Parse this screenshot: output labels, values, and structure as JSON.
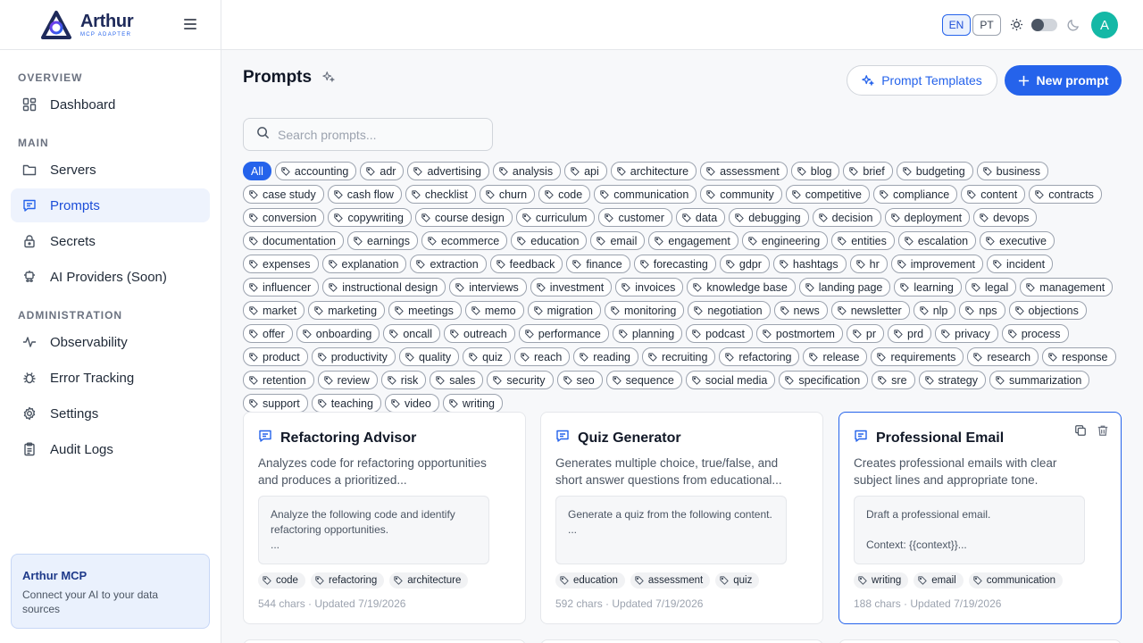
{
  "brand": {
    "name": "Arthur",
    "subtitle": "MCP ADAPTER"
  },
  "sidebar": {
    "sections": [
      {
        "label": "OVERVIEW"
      },
      {
        "label": "MAIN"
      },
      {
        "label": "ADMINISTRATION"
      }
    ],
    "items": [
      {
        "label": "Dashboard",
        "icon": "dashboard-icon"
      },
      {
        "label": "Servers",
        "icon": "folder-icon"
      },
      {
        "label": "Prompts",
        "icon": "message-icon",
        "active": true
      },
      {
        "label": "Secrets",
        "icon": "lock-icon"
      },
      {
        "label": "AI Providers (Soon)",
        "icon": "chip-icon"
      },
      {
        "label": "Observability",
        "icon": "activity-icon"
      },
      {
        "label": "Error Tracking",
        "icon": "bug-icon"
      },
      {
        "label": "Settings",
        "icon": "gear-icon"
      },
      {
        "label": "Audit Logs",
        "icon": "clipboard-icon"
      }
    ],
    "promo": {
      "title": "Arthur MCP",
      "text": "Connect your AI to your data sources"
    }
  },
  "topbar": {
    "languages": [
      "EN",
      "PT"
    ],
    "active_language": "EN",
    "theme": "light",
    "avatar_initial": "A",
    "avatar_color": "#14b8a6"
  },
  "page": {
    "title": "Prompts",
    "templates_button": "Prompt Templates",
    "new_button": "New prompt",
    "search_placeholder": "Search prompts..."
  },
  "filters": {
    "all_label": "All",
    "tags": [
      "accounting",
      "adr",
      "advertising",
      "analysis",
      "api",
      "architecture",
      "assessment",
      "blog",
      "brief",
      "budgeting",
      "business",
      "case study",
      "cash flow",
      "checklist",
      "churn",
      "code",
      "communication",
      "community",
      "competitive",
      "compliance",
      "content",
      "contracts",
      "conversion",
      "copywriting",
      "course design",
      "curriculum",
      "customer",
      "data",
      "debugging",
      "decision",
      "deployment",
      "devops",
      "documentation",
      "earnings",
      "ecommerce",
      "education",
      "email",
      "engagement",
      "engineering",
      "entities",
      "escalation",
      "executive",
      "expenses",
      "explanation",
      "extraction",
      "feedback",
      "finance",
      "forecasting",
      "gdpr",
      "hashtags",
      "hr",
      "improvement",
      "incident",
      "influencer",
      "instructional design",
      "interviews",
      "investment",
      "invoices",
      "knowledge base",
      "landing page",
      "learning",
      "legal",
      "management",
      "market",
      "marketing",
      "meetings",
      "memo",
      "migration",
      "monitoring",
      "negotiation",
      "news",
      "newsletter",
      "nlp",
      "nps",
      "objections",
      "offer",
      "onboarding",
      "oncall",
      "outreach",
      "performance",
      "planning",
      "podcast",
      "postmortem",
      "pr",
      "prd",
      "privacy",
      "process",
      "product",
      "productivity",
      "quality",
      "quiz",
      "reach",
      "reading",
      "recruiting",
      "refactoring",
      "release",
      "requirements",
      "research",
      "response",
      "retention",
      "review",
      "risk",
      "sales",
      "security",
      "seo",
      "sequence",
      "social media",
      "specification",
      "sre",
      "strategy",
      "summarization",
      "support",
      "teaching",
      "video",
      "writing"
    ]
  },
  "cards": [
    {
      "title": "Refactoring Advisor",
      "description": "Analyzes code for refactoring opportunities and produces a prioritized...",
      "body": "Analyze the following code and identify refactoring opportunities.\n...",
      "tags": [
        "code",
        "refactoring",
        "architecture"
      ],
      "meta": "544 chars · Updated 7/19/2026"
    },
    {
      "title": "Quiz Generator",
      "description": "Generates multiple choice, true/false, and short answer questions from educational...",
      "body": "Generate a quiz from the following content.\n...",
      "tags": [
        "education",
        "assessment",
        "quiz"
      ],
      "meta": "592 chars · Updated 7/19/2026"
    },
    {
      "title": "Professional Email",
      "description": "Creates professional emails with clear subject lines and appropriate tone.",
      "body": "Draft a professional email.\n\nContext: {{context}}...",
      "tags": [
        "writing",
        "email",
        "communication"
      ],
      "meta": "188 chars · Updated 7/19/2026",
      "highlighted": true
    }
  ],
  "colors": {
    "accent": "#2563eb",
    "active_bg": "#eef3fd",
    "border": "#e5e7eb"
  }
}
